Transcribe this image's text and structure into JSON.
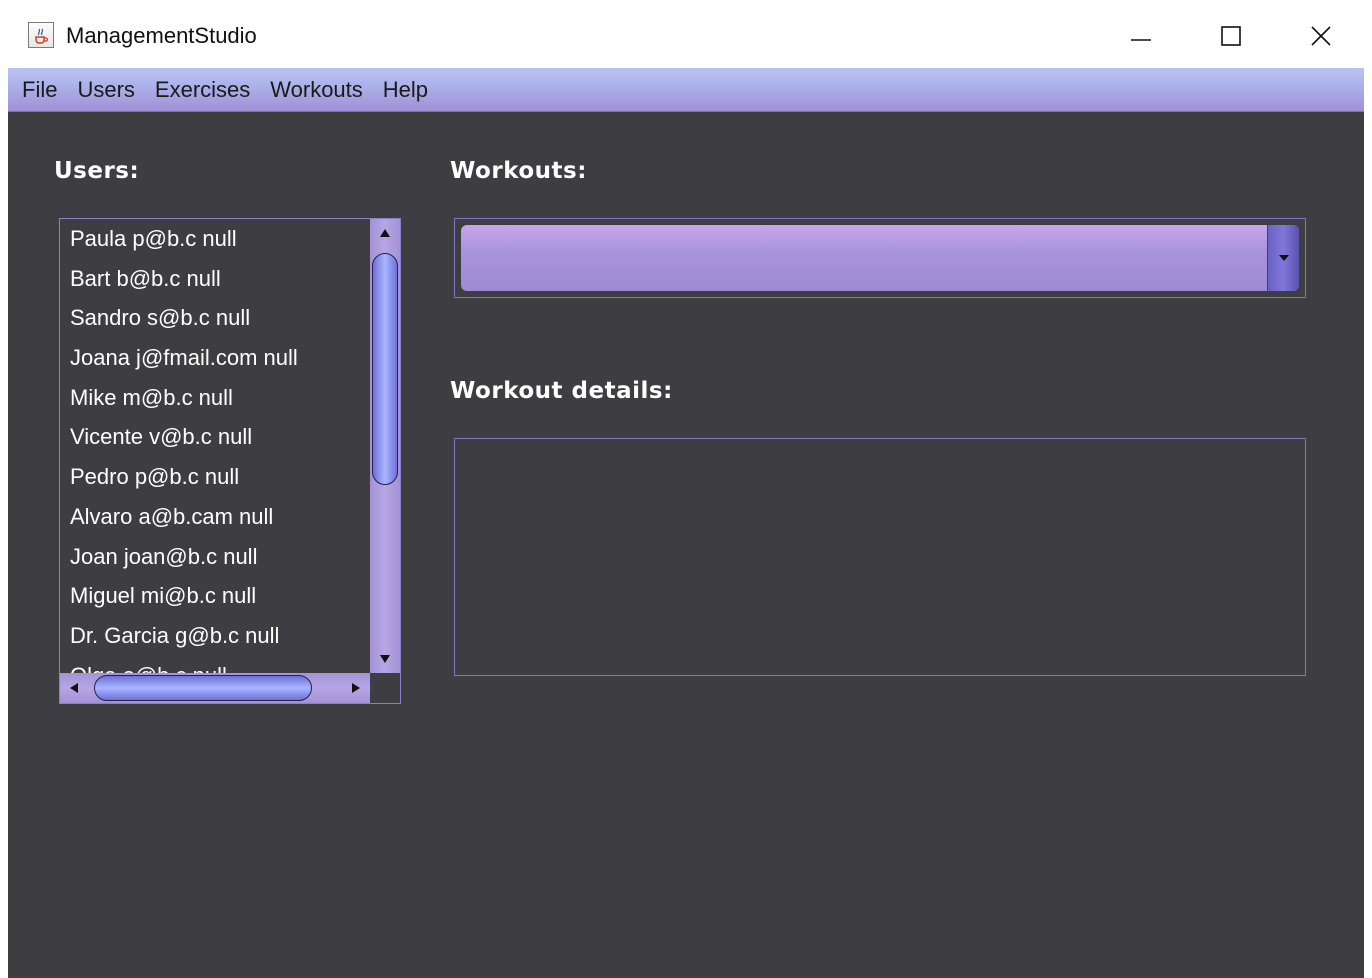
{
  "window": {
    "title": "ManagementStudio"
  },
  "menu": {
    "items": [
      "File",
      "Users",
      "Exercises",
      "Workouts",
      "Help"
    ]
  },
  "users": {
    "label": "Users:",
    "items": [
      "Paula p@b.c null",
      "Bart b@b.c null",
      "Sandro s@b.c null",
      "Joana j@fmail.com null",
      "Mike m@b.c null",
      "Vicente v@b.c null",
      "Pedro p@b.c null",
      "Alvaro a@b.cam null",
      "Joan joan@b.c null",
      "Miguel mi@b.c null",
      "Dr. Garcia g@b.c null",
      "Olga o@b.c null"
    ]
  },
  "workouts": {
    "label": "Workouts:",
    "selected": ""
  },
  "details": {
    "label": "Workout details:",
    "text": ""
  },
  "colors": {
    "background": "#3e3d42",
    "menubar": "#aab0e8",
    "accent": "#a994dc",
    "scroll_thumb": "#8f9cf0"
  },
  "icons": {
    "app": "java-cup-icon",
    "minimize": "minimize-icon",
    "maximize": "maximize-icon",
    "close": "close-icon"
  }
}
